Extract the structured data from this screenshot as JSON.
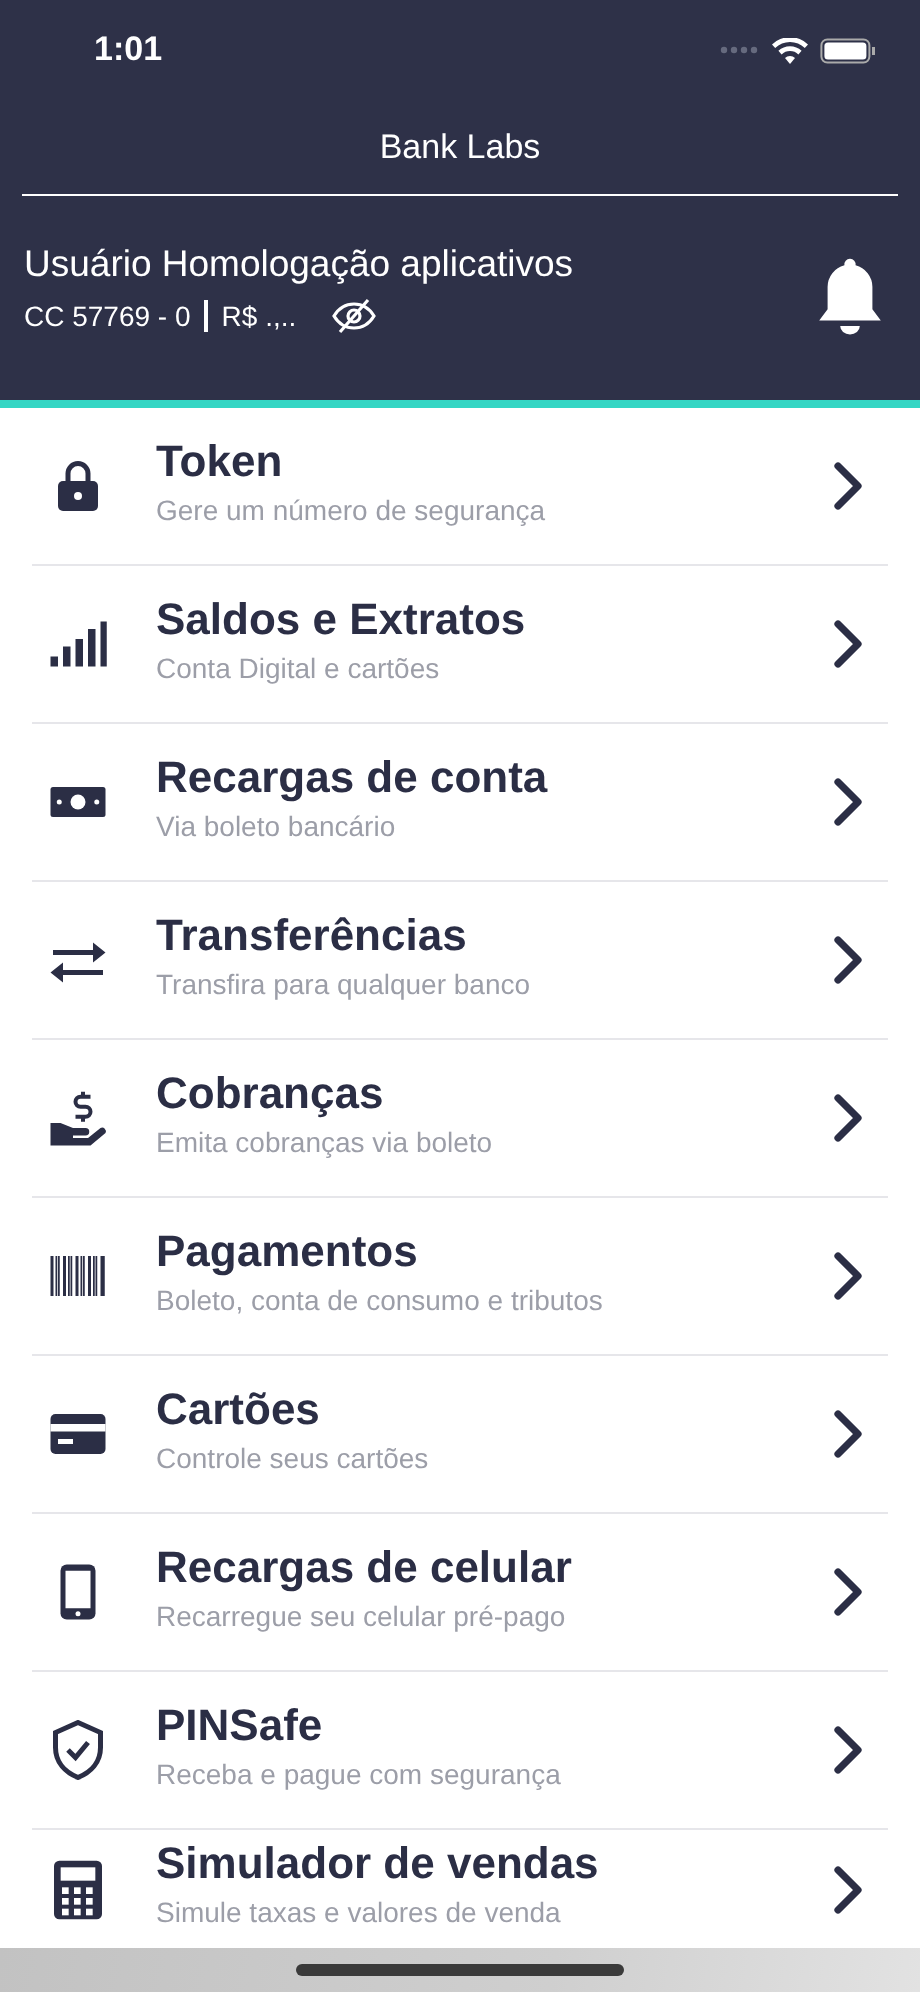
{
  "status_bar": {
    "time": "1:01"
  },
  "header": {
    "title": "Bank Labs"
  },
  "account": {
    "name": "Usuário Homologação aplicativos",
    "number": "CC 57769 - 0",
    "balance": "R$ .,..",
    "balance_hidden": true
  },
  "menu": [
    {
      "kind": "lock",
      "title": "Token",
      "subtitle": "Gere um número de segurança"
    },
    {
      "kind": "bars",
      "title": "Saldos e Extratos",
      "subtitle": "Conta Digital e cartões"
    },
    {
      "kind": "money",
      "title": "Recargas de conta",
      "subtitle": "Via boleto bancário"
    },
    {
      "kind": "transfer",
      "title": "Transferências",
      "subtitle": "Transfira para qualquer banco"
    },
    {
      "kind": "charge",
      "title": "Cobranças",
      "subtitle": "Emita cobranças via boleto"
    },
    {
      "kind": "barcode",
      "title": "Pagamentos",
      "subtitle": "Boleto, conta de consumo e tributos"
    },
    {
      "kind": "card",
      "title": "Cartões",
      "subtitle": "Controle seus cartões"
    },
    {
      "kind": "phone",
      "title": "Recargas de celular",
      "subtitle": "Recarregue seu celular pré-pago"
    },
    {
      "kind": "shield",
      "title": "PINSafe",
      "subtitle": "Receba e pague com segurança"
    },
    {
      "kind": "calculator",
      "title": "Simulador de vendas",
      "subtitle": "Simule taxas e valores de venda"
    }
  ]
}
